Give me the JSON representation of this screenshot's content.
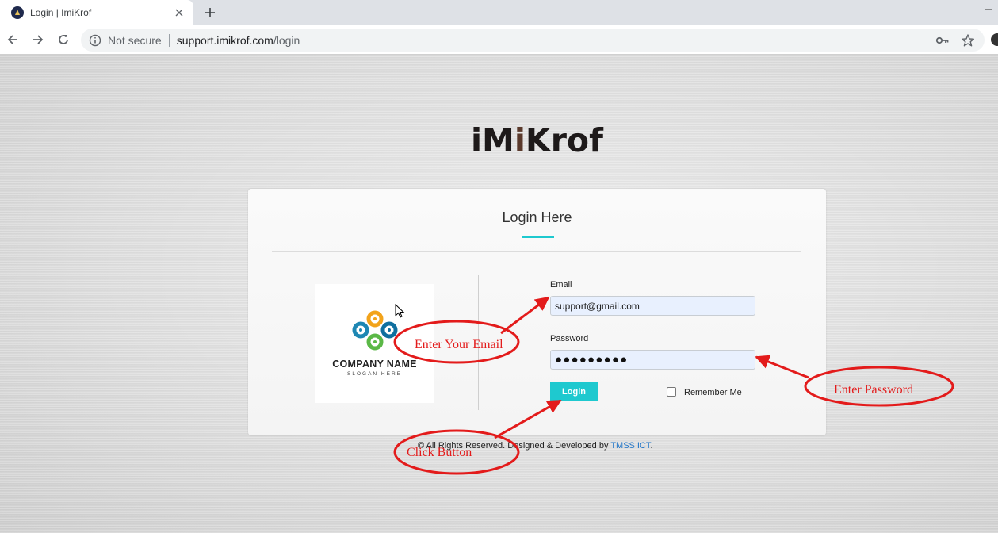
{
  "browser": {
    "tab_title": "Login | ImiKrof",
    "security_label": "Not secure",
    "url_host": "support.imikrof.com",
    "url_path": "/login"
  },
  "brand": {
    "logo_text_a": "iM",
    "logo_text_b": "i",
    "logo_text_c": "Krof"
  },
  "login_card": {
    "title": "Login Here",
    "company_name": "COMPANY NAME",
    "company_slogan": "SLOGAN HERE",
    "email_label": "Email",
    "email_value": "support@gmail.com",
    "password_label": "Password",
    "password_mask": "●●●●●●●●●",
    "login_button": "Login",
    "remember_me": "Remember Me"
  },
  "footer": {
    "text": "© All Rights Reserved. Designed & Developed by ",
    "link_text": "TMSS ICT",
    "suffix": "."
  },
  "annotations": {
    "email_note": "Enter Your Email",
    "password_note": "Enter Password",
    "button_note": "Click Button"
  },
  "colors": {
    "accent": "#1ec9cf",
    "annotation": "#e31b1b",
    "link": "#1d73c7",
    "field_bg": "#e8f0fe"
  }
}
